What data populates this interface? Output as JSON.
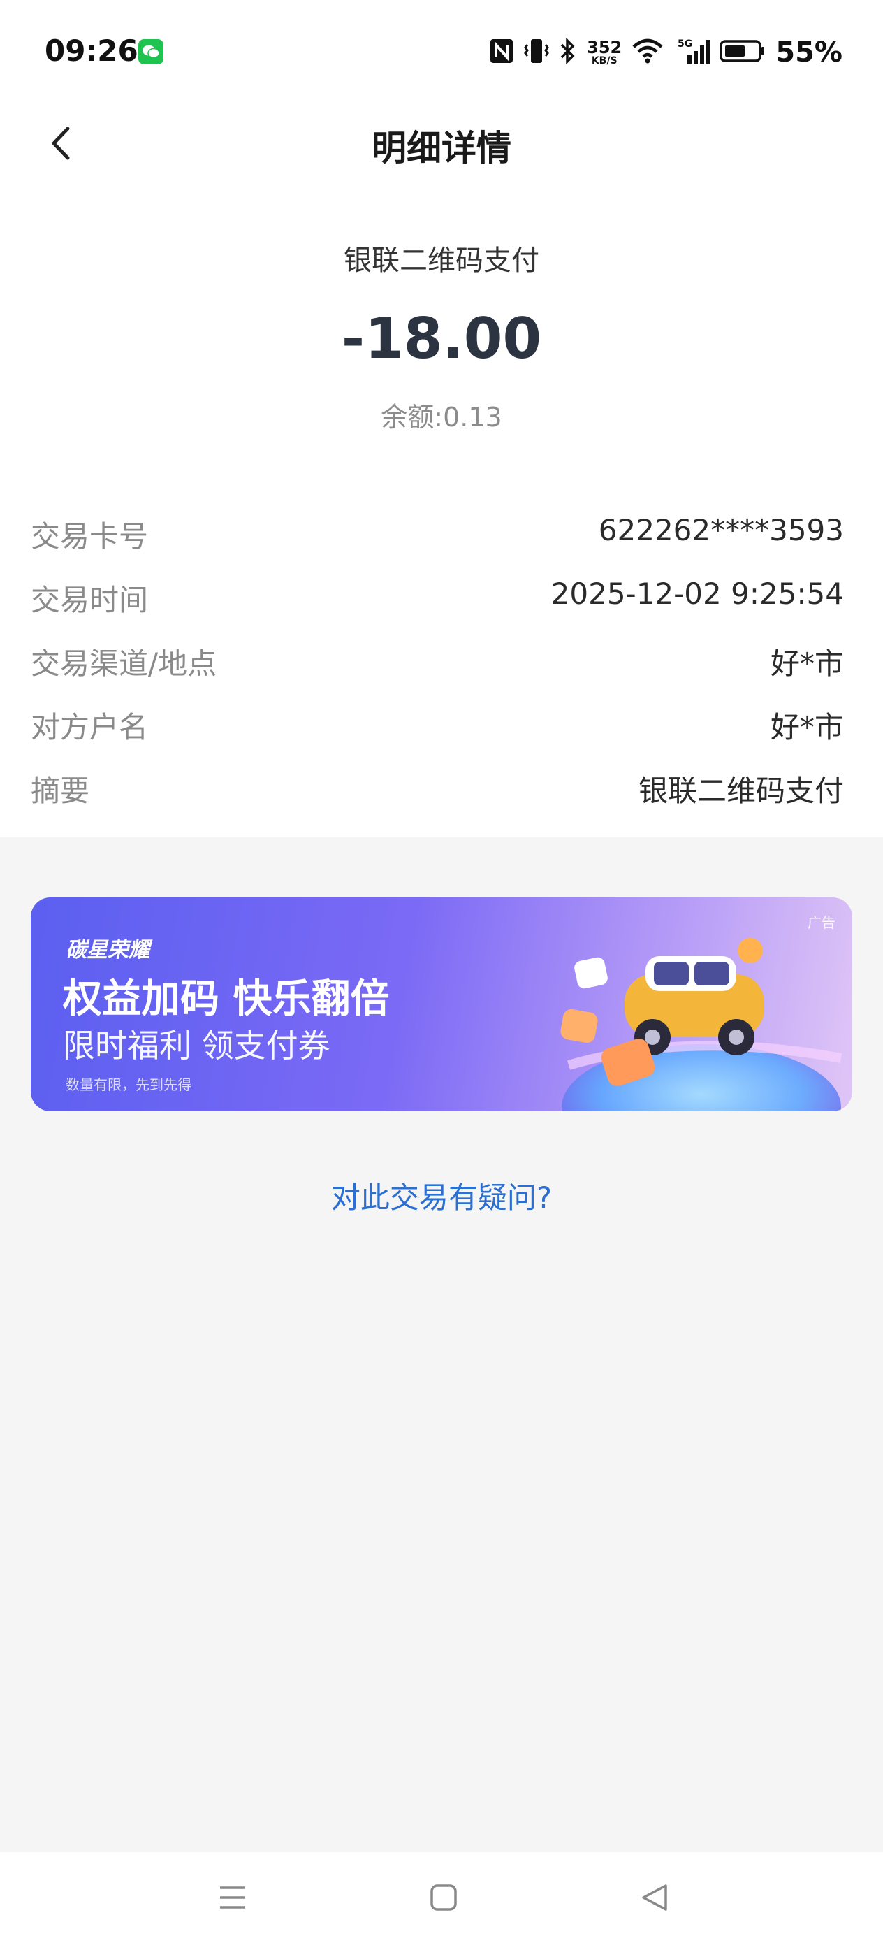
{
  "status_bar": {
    "time": "09:26",
    "speed_value": "352",
    "speed_unit": "KB/S",
    "battery_percent": "55%",
    "icons": [
      "wechat-icon",
      "nfc-icon",
      "vibrate-icon",
      "bluetooth-icon",
      "wifi-icon",
      "signal-5g-icon",
      "battery-icon"
    ]
  },
  "header": {
    "title": "明细详情",
    "back_icon": "chevron-left-icon"
  },
  "transaction": {
    "type": "银联二维码支付",
    "amount": "-18.00",
    "balance": "余额:0.13"
  },
  "details": [
    {
      "label": "交易卡号",
      "value": "622262****3593"
    },
    {
      "label": "交易时间",
      "value": "2025-12-02 9:25:54"
    },
    {
      "label": "交易渠道/地点",
      "value": "好*市"
    },
    {
      "label": "对方户名",
      "value": "好*市"
    },
    {
      "label": "摘要",
      "value": "银联二维码支付"
    }
  ],
  "ad": {
    "tag": "广告",
    "brand": "碳星荣耀",
    "headline": "权益加码 快乐翻倍",
    "subline": "限时福利 领支付券",
    "footnote": "数量有限，先到先得"
  },
  "question_link": "对此交易有疑问?",
  "nav_bar": {
    "icons": [
      "menu-icon",
      "home-square-icon",
      "back-triangle-icon"
    ]
  },
  "colors": {
    "accent_link": "#2a6fd1",
    "amount_text": "#2b3440",
    "page_bg": "#f5f5f5",
    "ad_gradient_start": "#5b5ff0",
    "ad_gradient_end": "#e0c6f6"
  }
}
